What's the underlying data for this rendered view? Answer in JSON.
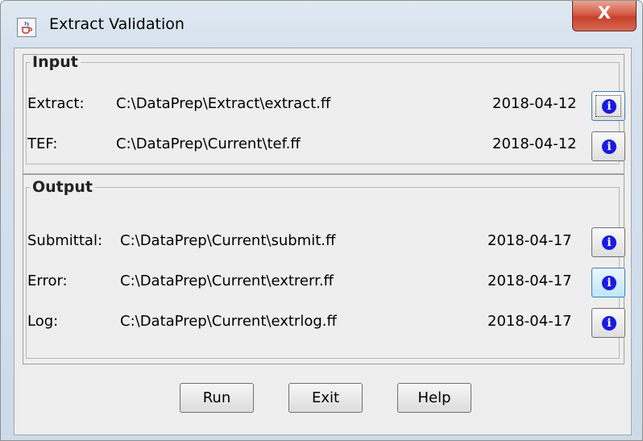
{
  "window": {
    "title": "Extract Validation",
    "close_label": "X"
  },
  "input": {
    "legend": "Input",
    "rows": [
      {
        "label": "Extract:",
        "path": "C:\\DataPrep\\Extract\\extract.ff",
        "date": "2018-04-12"
      },
      {
        "label": "TEF:",
        "path": "C:\\DataPrep\\Current\\tef.ff",
        "date": "2018-04-12"
      }
    ]
  },
  "output": {
    "legend": "Output",
    "rows": [
      {
        "label": "Submittal:",
        "path": "C:\\DataPrep\\Current\\submit.ff",
        "date": "2018-04-17"
      },
      {
        "label": "Error:",
        "path": "C:\\DataPrep\\Current\\extrerr.ff",
        "date": "2018-04-17"
      },
      {
        "label": "Log:",
        "path": "C:\\DataPrep\\Current\\extrlog.ff",
        "date": "2018-04-17"
      }
    ]
  },
  "info_icon_glyph": "i",
  "buttons": {
    "run": "Run",
    "exit": "Exit",
    "help": "Help"
  },
  "icons": {
    "app": "java-cup-icon",
    "info": "info-icon",
    "close": "close-icon"
  },
  "colors": {
    "info_icon": "#1a1ae0",
    "close_button": "#c6402b",
    "title_bar": "#d6e2ee"
  }
}
